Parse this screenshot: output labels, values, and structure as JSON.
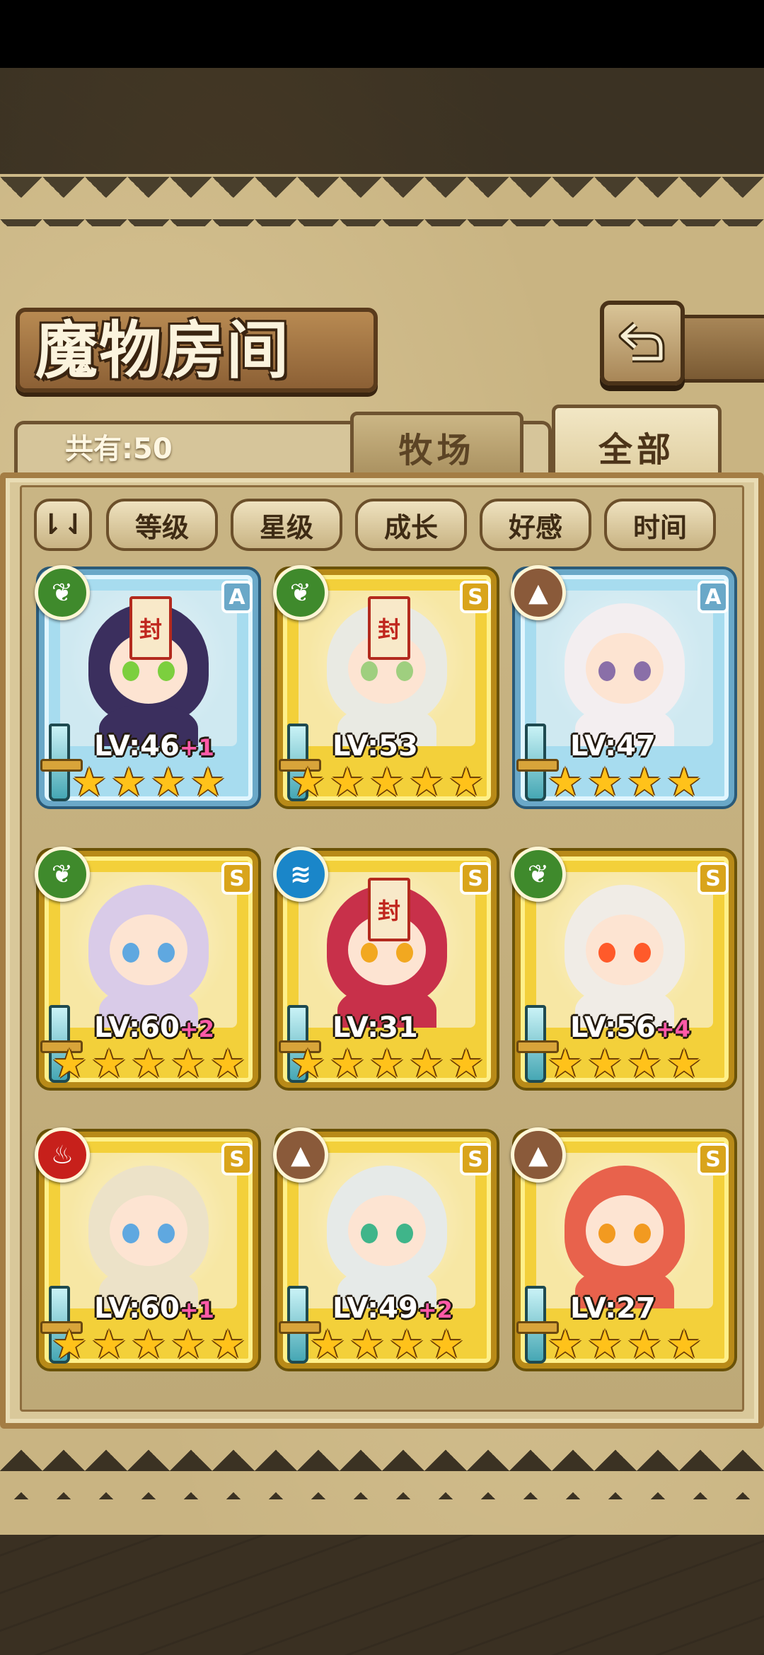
{
  "header": {
    "title": "魔物房间",
    "back_icon": "return-arrow-icon"
  },
  "tabs": [
    {
      "label": "牧场",
      "active": false
    },
    {
      "label": "全部",
      "active": true
    }
  ],
  "count_label": "共有:50",
  "filters": {
    "toggle_icon": "sort-toggle-icon",
    "toggle_glyph": "⇂⇃",
    "buttons": [
      "等级",
      "星级",
      "成长",
      "好感",
      "时间"
    ]
  },
  "colors": {
    "nature": "#3f8a2c",
    "water": "#1a86c9",
    "earth": "#8a5a3a",
    "fire": "#c7201b",
    "rank_s": "#d9a41b",
    "rank_a": "#6aa8c8"
  },
  "monsters": [
    {
      "element": "nature",
      "element_glyph": "❦",
      "rank": "A",
      "level": "LV:46",
      "bonus": "+1",
      "stars": 4,
      "sealed": true,
      "hair": "#3b2f5e",
      "eye": "#7ccf3e"
    },
    {
      "element": "nature",
      "element_glyph": "❦",
      "rank": "S",
      "level": "LV:53",
      "bonus": "",
      "stars": 5,
      "sealed": true,
      "hair": "#e9eae3",
      "eye": "#9fcf7f"
    },
    {
      "element": "earth",
      "element_glyph": "▲",
      "rank": "A",
      "level": "LV:47",
      "bonus": "",
      "stars": 4,
      "sealed": false,
      "hair": "#f3eef0",
      "eye": "#8a6fa8"
    },
    {
      "element": "nature",
      "element_glyph": "❦",
      "rank": "S",
      "level": "LV:60",
      "bonus": "+2",
      "stars": 5,
      "sealed": false,
      "hair": "#d9cbe8",
      "eye": "#5fa8e0"
    },
    {
      "element": "water",
      "element_glyph": "≋",
      "rank": "S",
      "level": "LV:31",
      "bonus": "",
      "stars": 5,
      "sealed": true,
      "hair": "#c8304a",
      "eye": "#f2a820"
    },
    {
      "element": "nature",
      "element_glyph": "❦",
      "rank": "S",
      "level": "LV:56",
      "bonus": "+4",
      "stars": 4,
      "sealed": false,
      "hair": "#f0ece6",
      "eye": "#ff5a2a"
    },
    {
      "element": "fire",
      "element_glyph": "♨",
      "rank": "S",
      "level": "LV:60",
      "bonus": "+1",
      "stars": 5,
      "sealed": false,
      "hair": "#ece2c8",
      "eye": "#5fa8e0"
    },
    {
      "element": "earth",
      "element_glyph": "▲",
      "rank": "S",
      "level": "LV:49",
      "bonus": "+2",
      "stars": 4,
      "sealed": false,
      "hair": "#e6eae8",
      "eye": "#3fb58a"
    },
    {
      "element": "earth",
      "element_glyph": "▲",
      "rank": "S",
      "level": "LV:27",
      "bonus": "",
      "stars": 4,
      "sealed": false,
      "hair": "#e8624c",
      "eye": "#f29a20"
    }
  ],
  "seal_glyph": "封",
  "star_glyph": "★"
}
